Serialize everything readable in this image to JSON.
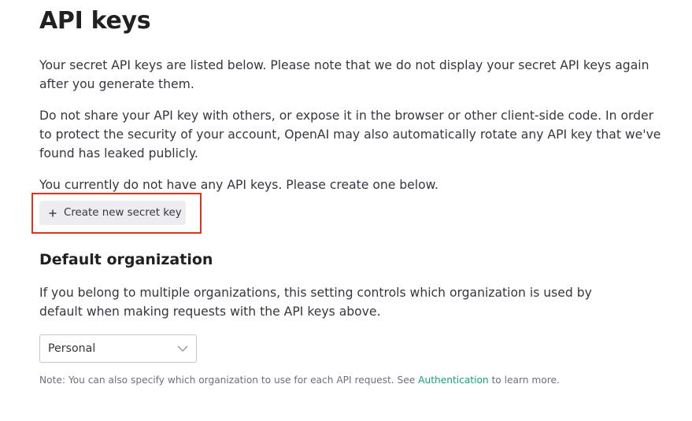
{
  "page": {
    "title": "API keys"
  },
  "intro": {
    "paragraph1": "Your secret API keys are listed below. Please note that we do not display your secret API keys again after you generate them.",
    "paragraph2": "Do not share your API key with others, or expose it in the browser or other client-side code. In order to protect the security of your account, OpenAI may also automatically rotate any API key that we've found has leaked publicly.",
    "paragraph3": "You currently do not have any API keys. Please create one below."
  },
  "actions": {
    "create_key_label": "Create new secret key",
    "create_key_icon": "plus-icon"
  },
  "default_org": {
    "title": "Default organization",
    "description": "If you belong to multiple organizations, this setting controls which organization is used by default when making requests with the API keys above.",
    "selected": "Personal",
    "select_icon": "chevron-down-icon"
  },
  "note": {
    "prefix": "Note: You can also specify which organization to use for each API request. See ",
    "link_text": "Authentication",
    "suffix": " to learn more."
  },
  "colors": {
    "highlight": "#e4311b",
    "link": "#10a37f",
    "button_bg": "#ececf1"
  }
}
